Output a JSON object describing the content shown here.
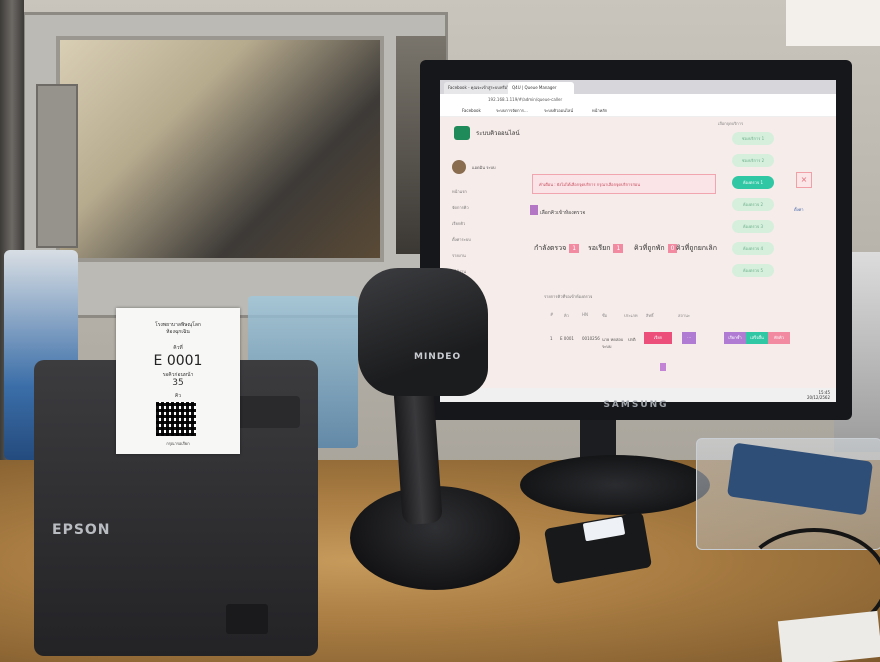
{
  "devices": {
    "printer_brand": "EPSON",
    "scanner_brand": "MINDEO",
    "monitor_brand": "SAMSUNG"
  },
  "receipt": {
    "header_line1": "โรงพยาบาลพิษณุโลก",
    "header_line2": "ห้องฉุกเฉิน",
    "label_queue": "คิวที่",
    "queue_number": "E 0001",
    "label_waiting": "รอคิวก่อนหน้า",
    "waiting_count": "35",
    "label_unit": "คิว",
    "footer": "กรุณารอเรียก"
  },
  "browser": {
    "tabs": [
      {
        "label": "Facebook - คุณจะเข้าสู่ระบบหรือไม่..."
      },
      {
        "label": "Q4U | Queue Manager"
      }
    ],
    "url": "192.168.1.119/#/admin/queue-caller",
    "bookmarks": [
      "Facebook",
      "ระบบการจัดการ...",
      "ระบบคิวออนไลน์",
      "หน้าหลัก"
    ]
  },
  "app": {
    "title": "ระบบคิวออนไลน์",
    "user_name": "แอดมิน ระบบ",
    "sidebar": [
      "หน้าแรก",
      "จัดการคิว",
      "เรียกคิว",
      "ตั้งค่าระบบ",
      "รายงาน",
      "ผู้ใช้งาน",
      "ออกจากระบบ"
    ],
    "alert_text": "คำเตือน : ยังไม่ได้เลือกจุดบริการ กรุณาเลือกจุดบริการก่อน",
    "section_title": "เลือกคิวเข้าห้องตรวจ",
    "stats": [
      {
        "label": "กำลังตรวจ",
        "value": "1"
      },
      {
        "label": "รอเรียก",
        "value": "1"
      },
      {
        "label": "คิวที่ถูกพัก",
        "value": "0"
      },
      {
        "label": "คิวที่ถูกยกเลิก",
        "value": ""
      }
    ],
    "table_title": "รายการคิวที่รอเข้าห้องตรวจ",
    "table_headers": [
      "#",
      "คิว",
      "HN",
      "ชื่อ",
      "ประเภท",
      "สิทธิ์",
      "สถานะ"
    ],
    "table_row": [
      "1",
      "E 0001",
      "0010256",
      "นาย ทดสอบ ระบบ",
      "ปกติ",
      "บัตรทอง"
    ],
    "row_button_call": "เรียก",
    "right_panel_title": "เลือกจุดบริการ",
    "counters": [
      {
        "label": "ช่องบริการ 1",
        "active": false
      },
      {
        "label": "ช่องบริการ 2",
        "active": false
      },
      {
        "label": "ห้องตรวจ 1",
        "active": true
      },
      {
        "label": "ห้องตรวจ 2",
        "active": false
      },
      {
        "label": "ห้องตรวจ 3",
        "active": false
      },
      {
        "label": "ห้องตรวจ 4",
        "active": false
      },
      {
        "label": "ห้องตรวจ 5",
        "active": false
      }
    ],
    "side_link": "ตั้งค่า",
    "action_buttons": [
      {
        "label": "เรียกซ้ำ",
        "color": "#b07bd3"
      },
      {
        "label": "เสร็จสิ้น",
        "color": "#2fc7a4"
      },
      {
        "label": "พักคิว",
        "color": "#f28ba2"
      }
    ],
    "clock_time": "15:45",
    "clock_date": "20/12/2562"
  },
  "colors": {
    "accent": "#2fc7a4",
    "primary_pink": "#ec4f7a",
    "purple": "#b07bd3"
  }
}
